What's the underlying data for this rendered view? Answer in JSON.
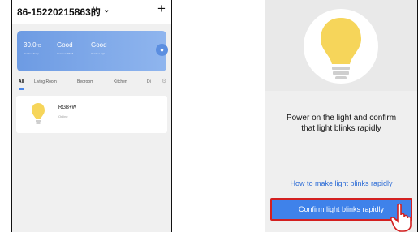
{
  "left_screen": {
    "account": "86-15220215863的",
    "weather": [
      {
        "value": "30.0",
        "unit": "°C",
        "caption": "Outdoor Temp."
      },
      {
        "value": "Good",
        "caption": "Outdoor PM2.5"
      },
      {
        "value": "Good",
        "caption": "Outdoor AQI"
      }
    ],
    "tabs": [
      "All",
      "Living Room",
      "Bedroom",
      "Kitchen",
      "Di"
    ],
    "device": {
      "name": "RGB+W",
      "status": "Online"
    }
  },
  "right_screen": {
    "instruction_line1": "Power on the light and confirm",
    "instruction_line2": "that light blinks  rapidly",
    "help_link": "How to make light blinks rapidly",
    "confirm_button": "Confirm light blinks rapidly"
  },
  "colors": {
    "accent": "#3f82ea",
    "highlight": "#d32020",
    "bulb": "#f6d55a"
  }
}
